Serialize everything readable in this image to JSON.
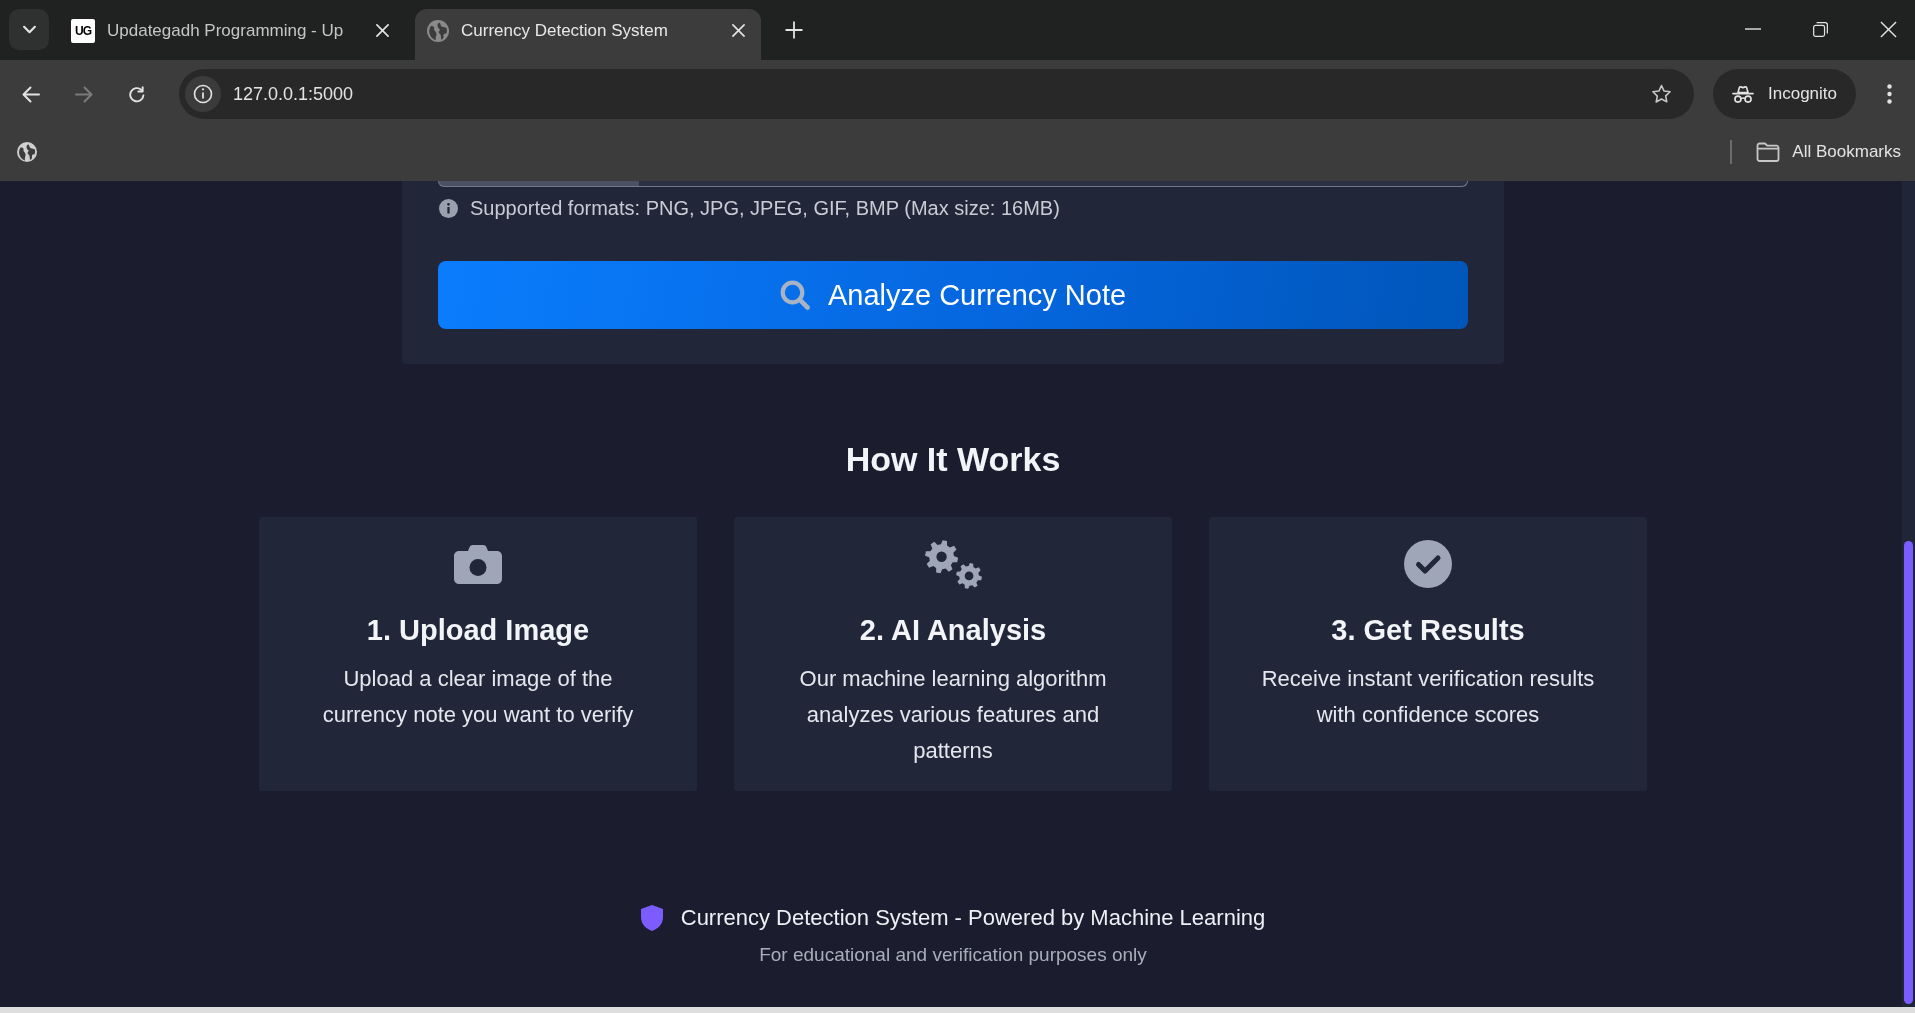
{
  "browser": {
    "tabs": [
      {
        "title": "Updategadh Programming - Up",
        "selected": false,
        "favicon": {
          "kind": "logo",
          "text": "UG"
        }
      },
      {
        "title": "Currency Detection System",
        "selected": true,
        "favicon": {
          "kind": "globe"
        }
      }
    ],
    "nav_buttons": [
      {
        "kind": "back",
        "disabled": false
      },
      {
        "kind": "forward",
        "disabled": true
      },
      {
        "kind": "reload",
        "disabled": false
      }
    ],
    "address": "127.0.0.1:5000",
    "profile_button": "Incognito",
    "all_bookmarks": "All Bookmarks"
  },
  "upload": {
    "hint": "Supported formats: PNG, JPG, JPEG, GIF, BMP (Max size: 16MB)",
    "button": "Analyze Currency Note"
  },
  "how_it_works": {
    "heading": "How It Works",
    "steps": [
      {
        "kind": "camera",
        "title": "1. Upload Image",
        "text": "Upload a clear image of the currency note you want to verify"
      },
      {
        "kind": "gears",
        "title": "2. AI Analysis",
        "text": "Our machine learning algorithm analyzes various features and patterns"
      },
      {
        "kind": "check",
        "title": "3. Get Results",
        "text": "Receive instant verification results with confidence scores"
      }
    ]
  },
  "footer": {
    "title": "Currency Detection System - Powered by Machine Learning",
    "note": "For educational and verification purposes only"
  }
}
